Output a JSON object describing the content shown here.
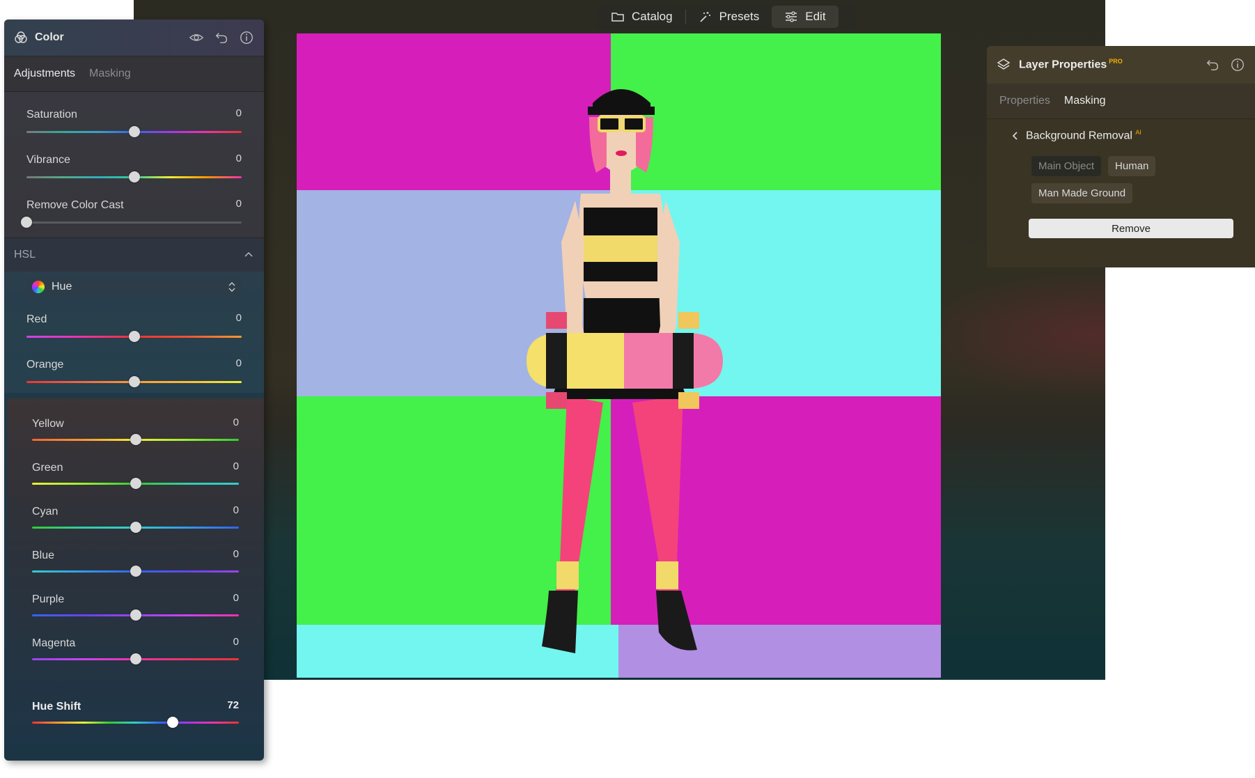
{
  "toolbar": {
    "catalog": "Catalog",
    "presets": "Presets",
    "edit": "Edit"
  },
  "color_panel": {
    "title": "Color",
    "tabs": {
      "adjustments": "Adjustments",
      "masking": "Masking"
    },
    "basic": [
      {
        "label": "Saturation",
        "value": "0",
        "pos": 0.5
      },
      {
        "label": "Vibrance",
        "value": "0",
        "pos": 0.5
      },
      {
        "label": "Remove Color Cast",
        "value": "0",
        "pos": 0.0
      }
    ],
    "hsl": {
      "title": "HSL",
      "mode": "Hue",
      "sliders": [
        {
          "label": "Red",
          "value": "0",
          "pos": 0.5
        },
        {
          "label": "Orange",
          "value": "0",
          "pos": 0.5
        }
      ],
      "sub_sliders": [
        {
          "label": "Yellow",
          "value": "0",
          "pos": 0.5
        },
        {
          "label": "Green",
          "value": "0",
          "pos": 0.5
        },
        {
          "label": "Cyan",
          "value": "0",
          "pos": 0.5
        },
        {
          "label": "Blue",
          "value": "0",
          "pos": 0.5
        },
        {
          "label": "Purple",
          "value": "0",
          "pos": 0.5
        },
        {
          "label": "Magenta",
          "value": "0",
          "pos": 0.5
        }
      ]
    },
    "hue_shift": {
      "label": "Hue Shift",
      "value": "72",
      "pos": 0.68
    }
  },
  "layer_panel": {
    "title": "Layer Properties",
    "badge": "PRO",
    "tabs": {
      "properties": "Properties",
      "masking": "Masking"
    },
    "section": "Background Removal",
    "section_badge": "AI",
    "chips": [
      "Main Object",
      "Human",
      "Man Made Ground"
    ],
    "remove_label": "Remove"
  },
  "colors": {
    "magenta": "#d61fba",
    "green": "#44f04a",
    "lavender": "#a3b3e3",
    "cyan": "#72f6ef",
    "accent_pro": "#f0b000"
  }
}
